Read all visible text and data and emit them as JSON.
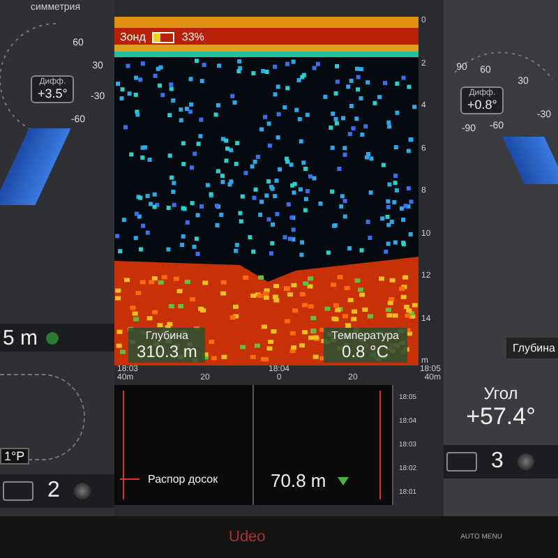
{
  "left_panel": {
    "title": "симметрия",
    "gauge": {
      "label": "Дифф.",
      "value": "+3.5°",
      "ticks": [
        "60",
        "30",
        "-30",
        "-60"
      ]
    },
    "distance": "5 m",
    "pitch": "1°P",
    "counter": "2"
  },
  "sonar": {
    "source_label": "Зонд",
    "battery": {
      "level": 0.33
    },
    "battery_text": "33%",
    "depth_ticks": [
      "0",
      "2",
      "4",
      "6",
      "8",
      "10",
      "12",
      "14"
    ],
    "depth_unit": "m",
    "readouts": [
      {
        "label": "Глубина",
        "value": "310.3 m"
      },
      {
        "label": "Температура",
        "value": "0.8 °C"
      }
    ]
  },
  "spread": {
    "time_labels": [
      "18:03",
      "18:04",
      "18:05"
    ],
    "x_ticks": [
      "40m",
      "20",
      "0",
      "20",
      "40m"
    ],
    "side_times": [
      "18:05",
      "18:04",
      "18:03",
      "18:02",
      "18:01"
    ],
    "legend": "Распор досок",
    "value": "70.8 m"
  },
  "right_panel": {
    "gauge": {
      "label": "Дифф.",
      "value": "+0.8°",
      "ticks": [
        "90",
        "60",
        "30",
        "-30",
        "-60",
        "-90"
      ]
    },
    "depth_label": "Глубина",
    "angle_label": "Угол",
    "angle_value": "+57.4°",
    "counter": "3"
  },
  "monitor": {
    "logo": "Udeo",
    "menu_text": "AUTO MENU"
  }
}
